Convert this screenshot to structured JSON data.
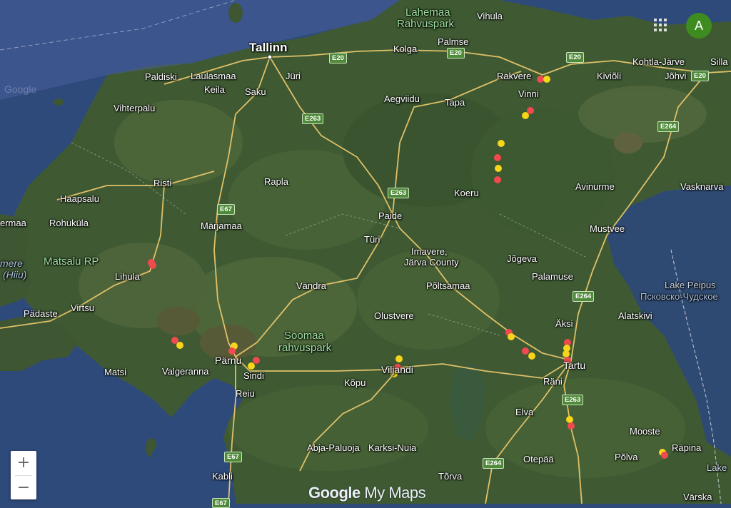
{
  "map": {
    "labels": {
      "tallinn": "Tallinn",
      "lahemaa": "Lahemaa",
      "lahemaa2": "Rahvuspark",
      "vihula": "Vihula",
      "palmse": "Palmse",
      "kolga": "Kolga",
      "rakvere": "Rakvere",
      "vinni": "Vinni",
      "kohtla": "Kohtla-Järve",
      "kivioli": "Kiviõli",
      "johvi": "Jõhvi",
      "silla": "Silla",
      "paldiski": "Paldiski",
      "laulasmaa": "Laulasmaa",
      "keila": "Keila",
      "saku": "Saku",
      "juri": "Jüri",
      "aegviidu": "Aegviidu",
      "tapa": "Tapa",
      "vihterpalu": "Vihterpalu",
      "risti": "Risti",
      "haapsalu": "Haapsalu",
      "rapla": "Rapla",
      "koeru": "Koeru",
      "avinurme": "Avinurme",
      "vasknarva": "Vasknarva",
      "ermaa": "ermaa",
      "rohukula": "Rohuküla",
      "marjamaa": "Märjamaa",
      "paide": "Paide",
      "mustvee": "Mustvee",
      "matsalu": "Matsalu RP",
      "mere": "mere",
      "hiiu": "(Hiiu)",
      "lihula": "Lihula",
      "turi": "Türi",
      "imavere": "Imavere,",
      "imavere2": "Järva County",
      "jogeva": "Jõgeva",
      "palamuse": "Palamuse",
      "vandra": "Vändra",
      "poltsamaa": "Põltsamaa",
      "peipus": "Lake Peipus",
      "peipus_ru": "Псковско-Чудское",
      "virtsu": "Virtsu",
      "padaste": "Pädaste",
      "olustvere": "Olustvere",
      "alatskivi": "Alatskivi",
      "soomaa": "Soomaa",
      "soomaa2": "rahvuspark",
      "aksi": "Äksi",
      "parnu": "Pärnu",
      "valgeranna": "Valgeranna",
      "sindi": "Sindi",
      "matsi": "Matsi",
      "viljandi": "Viljandi",
      "tartu": "Tartu",
      "rani": "Räni",
      "reiu": "Reiu",
      "kopu": "Kõpu",
      "elva": "Elva",
      "mooste": "Mooste",
      "abja": "Abja-Paluoja",
      "karksi": "Karksi-Nuia",
      "otepaa": "Otepää",
      "polva": "Põlva",
      "rapina": "Räpina",
      "torva": "Tõrva",
      "kabli": "Kabli",
      "varska": "Värska",
      "lake": "Lake"
    },
    "shields": {
      "e20a": "E20",
      "e20b": "E20",
      "e20c": "E20",
      "e20d": "E20",
      "e263a": "E263",
      "e263b": "E263",
      "e263c": "E263",
      "e264a": "E264",
      "e264b": "E264",
      "e264c": "E264",
      "e67a": "E67",
      "e67b": "E67",
      "e67c": "E67"
    },
    "watermark": "Google",
    "brand": {
      "google": "Google",
      "mymaps": " My Maps"
    }
  },
  "controls": {
    "zoom_in": "+",
    "zoom_out": "−",
    "avatar_letter": "A"
  },
  "marker_colors": {
    "red": "#f04a4f",
    "yellow": "#f6d51a"
  },
  "icons": {
    "apps": "apps-grid-icon"
  }
}
